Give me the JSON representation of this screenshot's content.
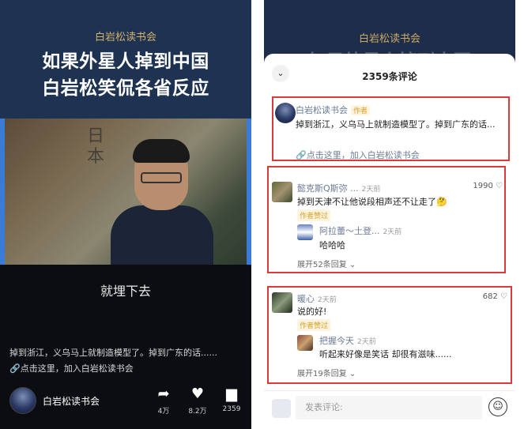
{
  "left": {
    "brand": "白岩松读书会",
    "headline_line1": "如果外星人掉到中国",
    "headline_line2": "白岩松笑侃各省反应",
    "calligraphy": "日\n本",
    "subtitle": "就埋下去",
    "description": "掉到浙江，义乌马上就制造模型了。掉到广东的话......",
    "link_text": "点击这里，加入白岩松读书会",
    "author": "白岩松读书会",
    "actions": [
      {
        "icon": "share-icon",
        "count": "4万"
      },
      {
        "icon": "heart-icon",
        "count": "8.2万"
      },
      {
        "icon": "comment-icon",
        "count": "2359"
      }
    ]
  },
  "right": {
    "brand": "白岩松读书会",
    "sheet_title": "2359条评论",
    "pinned": {
      "name": "白岩松读书会",
      "tag": "作者",
      "text": "掉到浙江，义乌马上就制造模型了。掉到广东的话...",
      "link": "点击这里，加入白岩松读书会"
    },
    "comment1": {
      "name": "懿克斯Q斯弥 ...",
      "time": "2天前",
      "likes": "1990",
      "text": "掉到天津不让他说段相声还不让走了🤔",
      "liked_tag": "作者赞过",
      "reply_name": "阿拉蕾～土登...",
      "reply_time": "2天前",
      "reply_text": "哈哈哈",
      "more": "展开52条回复"
    },
    "comment2": {
      "name": "暖心",
      "time": "2天前",
      "likes": "682",
      "text": "说的好!",
      "liked_tag": "作者赞过",
      "reply_name": "把握今天",
      "reply_time": "2天前",
      "reply_text": "听起来好像是笑话 却很有滋味......",
      "more": "展开19条回复"
    },
    "input_placeholder": "发表评论:",
    "emoji_icon": "smile-icon"
  },
  "colors": {
    "accent_red": "#d93a3a",
    "gold": "#d8a12a",
    "navy": "#1e3252"
  }
}
